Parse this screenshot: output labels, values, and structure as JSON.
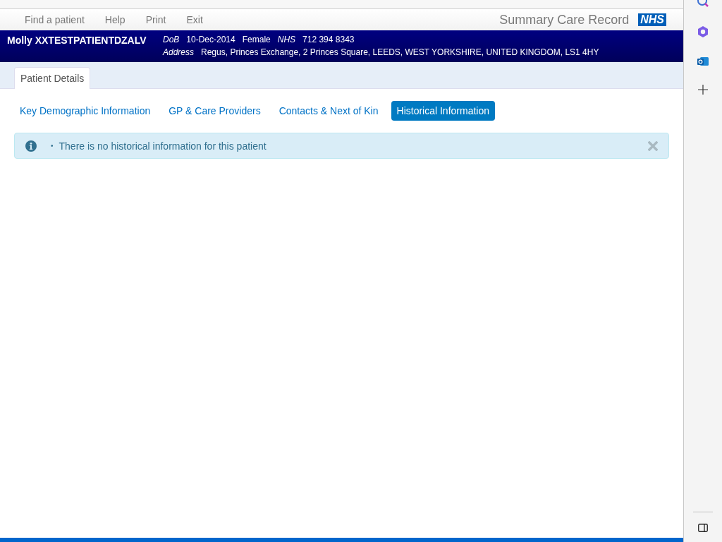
{
  "nav": {
    "links": [
      "Find a patient",
      "Help",
      "Print",
      "Exit"
    ],
    "brand": "Summary Care Record",
    "logo": "NHS"
  },
  "patient": {
    "name": "Molly XXTESTPATIENTDZALV",
    "dob_label": "DoB",
    "dob": "10-Dec-2014",
    "gender": "Female",
    "nhs_label": "NHS",
    "nhs": "712 394 8343",
    "address_label": "Address",
    "address": "Regus, Princes Exchange, 2 Princes Square, LEEDS, WEST YORKSHIRE, UNITED KINGDOM, LS1 4HY"
  },
  "tabs": [
    {
      "label": "Patient Details",
      "selected": true
    }
  ],
  "subtabs": [
    {
      "label": "Key Demographic Information",
      "selected": false
    },
    {
      "label": "GP & Care Providers",
      "selected": false
    },
    {
      "label": "Contacts & Next of Kin",
      "selected": false
    },
    {
      "label": "Historical Information",
      "selected": true
    }
  ],
  "alert": {
    "messages": [
      {
        "bullet": "•",
        "text": "There is no historical information for this patient"
      }
    ]
  }
}
